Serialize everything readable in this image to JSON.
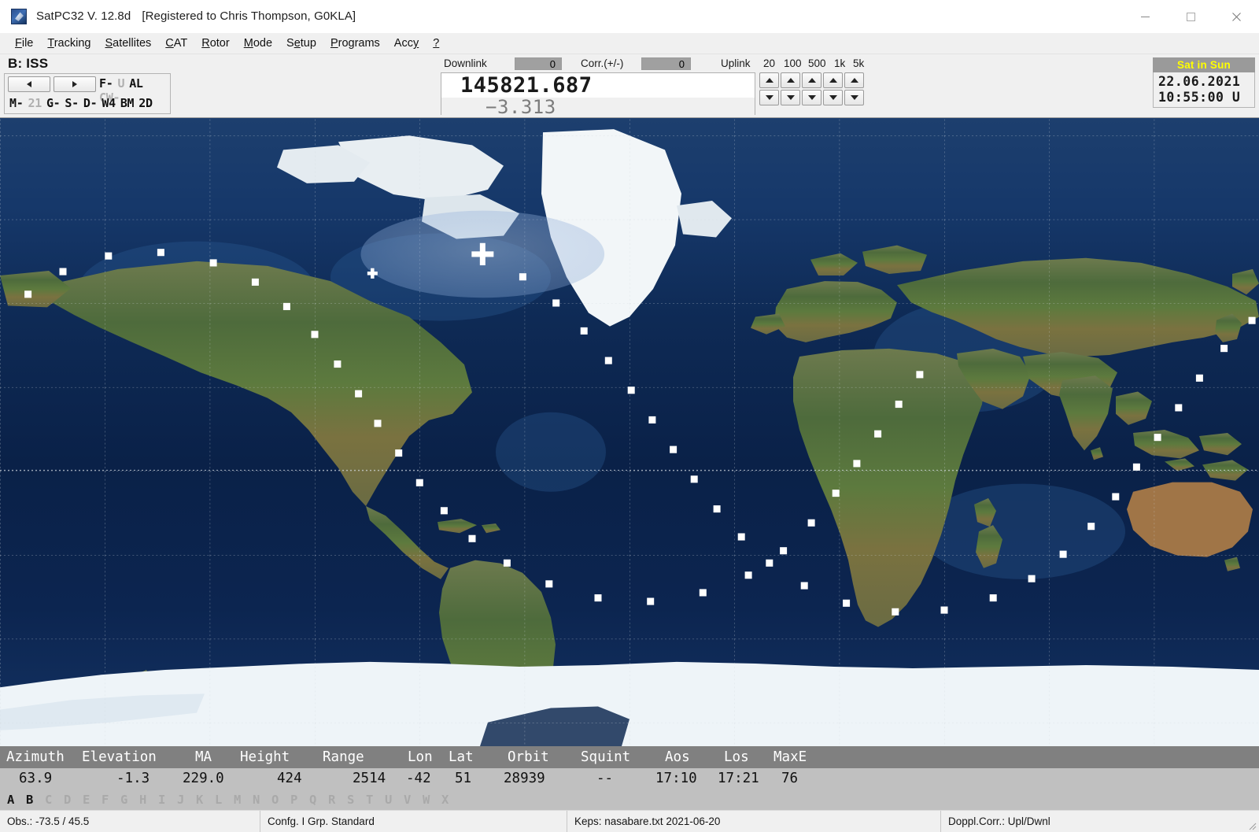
{
  "window": {
    "title": "SatPC32 V. 12.8d",
    "registration": "[Registered to Chris Thompson, G0KLA]",
    "minimize_label": "minimize",
    "maximize_label": "maximize",
    "close_label": "close"
  },
  "menu": {
    "items": [
      {
        "label": "File",
        "accel": "F"
      },
      {
        "label": "Tracking",
        "accel": "T"
      },
      {
        "label": "Satellites",
        "accel": "S"
      },
      {
        "label": "CAT",
        "accel": "C"
      },
      {
        "label": "Rotor",
        "accel": "R"
      },
      {
        "label": "Mode",
        "accel": "M"
      },
      {
        "label": "Setup",
        "accel": "e"
      },
      {
        "label": "Programs",
        "accel": "P"
      },
      {
        "label": "Accy",
        "accel": "y"
      },
      {
        "label": "?",
        "accel": ""
      }
    ]
  },
  "satellite_panel": {
    "label": "B: ISS",
    "prev_button": "◄",
    "next_button": "►",
    "flags_row1": [
      {
        "text": "F-",
        "active": true
      },
      {
        "text": "U",
        "active": false
      },
      {
        "text": "AL",
        "active": true
      },
      {
        "text": "CW-",
        "active": false
      }
    ],
    "flags_row2": [
      {
        "text": "M-",
        "active": true
      },
      {
        "text": "21",
        "active": false
      },
      {
        "text": "G-",
        "active": true
      },
      {
        "text": "S-",
        "active": true
      },
      {
        "text": "D-",
        "active": true
      },
      {
        "text": "W4",
        "active": true
      },
      {
        "text": "BM",
        "active": true
      },
      {
        "text": "2D",
        "active": true
      }
    ]
  },
  "frequency": {
    "downlink_label": "Downlink",
    "downlink_value": "0",
    "corr_label": "Corr.(+/-)",
    "corr_value": "0",
    "uplink_label": "Uplink",
    "step_labels": [
      "20",
      "100",
      "500",
      "1k",
      "5k"
    ],
    "main_value": "145821.687",
    "sub_value": "−3.313",
    "up_arrow": "▲",
    "down_arrow": "▼"
  },
  "clock": {
    "sun_badge": "Sat in Sun",
    "date": "22.06.2021",
    "time": "10:55:00 U",
    "sun_badge_color": "#ffff00",
    "sun_badge_bg": "#9a9a9a"
  },
  "map": {
    "satellite_marker_name": "satellite-position-cross",
    "observer_marker_name": "observer-position-cross",
    "footprint_name": "satellite-footprint",
    "grid_spacing_deg": 30,
    "satellite_lon": -42,
    "satellite_lat": 51,
    "observer_lon": -73.5,
    "observer_lat": 45.5,
    "footprint_radius_deg": 21.5,
    "orbit_track": [
      [
        -42,
        51
      ],
      [
        -30.5,
        44.5
      ],
      [
        -21,
        37
      ],
      [
        -13,
        29
      ],
      [
        -6,
        20.5
      ],
      [
        0.5,
        12
      ],
      [
        6.5,
        3.5
      ],
      [
        12.5,
        -5
      ],
      [
        18.5,
        -13.5
      ],
      [
        25,
        -22
      ],
      [
        32,
        -30
      ],
      [
        40,
        -37.5
      ],
      [
        50,
        -44
      ],
      [
        62,
        -49
      ],
      [
        76,
        -51.5
      ],
      [
        90,
        -51
      ],
      [
        104,
        -47.5
      ],
      [
        115,
        -42
      ],
      [
        124,
        -35
      ],
      [
        132,
        -27
      ],
      [
        139,
        -18.5
      ],
      [
        145,
        -10
      ],
      [
        151,
        -1.5
      ],
      [
        157,
        7
      ],
      [
        163,
        15.5
      ],
      [
        170,
        24
      ],
      [
        178,
        32
      ],
      [
        -172,
        39.5
      ],
      [
        -162,
        46
      ],
      [
        -149,
        50.5
      ],
      [
        -134,
        51.5
      ],
      [
        -119,
        48.5
      ],
      [
        -107,
        43
      ],
      [
        -98,
        36
      ],
      [
        -90,
        28
      ],
      [
        -83.5,
        19.5
      ],
      [
        -77.5,
        11
      ],
      [
        -72,
        2.5
      ],
      [
        -66,
        -6
      ],
      [
        -60,
        -14.5
      ],
      [
        -53,
        -22.5
      ],
      [
        -45,
        -30.5
      ],
      [
        -35,
        -37.5
      ],
      [
        -23,
        -43.5
      ],
      [
        -9,
        -47.5
      ],
      [
        6,
        -48.5
      ],
      [
        21,
        -46
      ],
      [
        34,
        -41
      ],
      [
        44,
        -34
      ],
      [
        52,
        -26
      ],
      [
        59,
        -17.5
      ],
      [
        65,
        -9
      ],
      [
        71,
        -0.5
      ],
      [
        77,
        8
      ],
      [
        83,
        16.5
      ]
    ]
  },
  "data_table": {
    "columns": [
      "Azimuth",
      "Elevation",
      "MA",
      "Height",
      "Range",
      "Lon",
      "Lat",
      "Orbit",
      "Squint",
      "Aos",
      "Los",
      "MaxE"
    ],
    "values": [
      "63.9",
      "-1.3",
      "229.0",
      "424",
      "2514",
      "-42",
      "51",
      "28939",
      "--",
      "17:10",
      "17:21",
      "76"
    ]
  },
  "letters": [
    {
      "ch": "A",
      "active": true
    },
    {
      "ch": "B",
      "active": true
    },
    {
      "ch": "C",
      "active": false
    },
    {
      "ch": "D",
      "active": false
    },
    {
      "ch": "E",
      "active": false
    },
    {
      "ch": "F",
      "active": false
    },
    {
      "ch": "G",
      "active": false
    },
    {
      "ch": "H",
      "active": false
    },
    {
      "ch": "I",
      "active": false
    },
    {
      "ch": "J",
      "active": false
    },
    {
      "ch": "K",
      "active": false
    },
    {
      "ch": "L",
      "active": false
    },
    {
      "ch": "M",
      "active": false
    },
    {
      "ch": "N",
      "active": false
    },
    {
      "ch": "O",
      "active": false
    },
    {
      "ch": "P",
      "active": false
    },
    {
      "ch": "Q",
      "active": false
    },
    {
      "ch": "R",
      "active": false
    },
    {
      "ch": "S",
      "active": false
    },
    {
      "ch": "T",
      "active": false
    },
    {
      "ch": "U",
      "active": false
    },
    {
      "ch": "V",
      "active": false
    },
    {
      "ch": "W",
      "active": false
    },
    {
      "ch": "X",
      "active": false
    }
  ],
  "statusbar": {
    "observer": "Obs.: -73.5 / 45.5",
    "config": "Confg. I  Grp. Standard",
    "keps": "Keps: nasabare.txt 2021-06-20",
    "doppler": "Doppl.Corr.: Upl/Dwnl"
  }
}
